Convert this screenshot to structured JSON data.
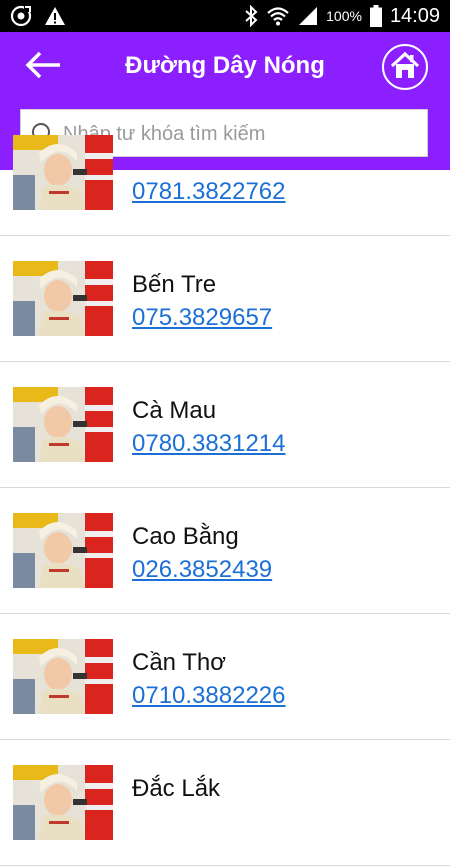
{
  "status_bar": {
    "battery": "100%",
    "time": "14:09",
    "icons": [
      "sync-icon",
      "warning-icon",
      "bluetooth-icon",
      "wifi-icon",
      "cell-signal-icon",
      "battery-icon"
    ]
  },
  "header": {
    "title": "Đường Dây Nóng",
    "back_icon": "arrow-left-icon",
    "home_icon": "home-icon"
  },
  "search": {
    "placeholder": "Nhập tư khóa tìm kiếm",
    "value": ""
  },
  "contacts": [
    {
      "name": "",
      "phone": "0781.3822762"
    },
    {
      "name": "Bến Tre",
      "phone": "075.3829657"
    },
    {
      "name": "Cà Mau",
      "phone": "0780.3831214"
    },
    {
      "name": "Cao Bằng",
      "phone": "026.3852439"
    },
    {
      "name": "Cần Thơ",
      "phone": "0710.3882226"
    },
    {
      "name": "Đắc Lắk",
      "phone": ""
    }
  ],
  "colors": {
    "app_bar": "#8c1fff",
    "link": "#1b6fd6",
    "status_bar": "#000000"
  }
}
